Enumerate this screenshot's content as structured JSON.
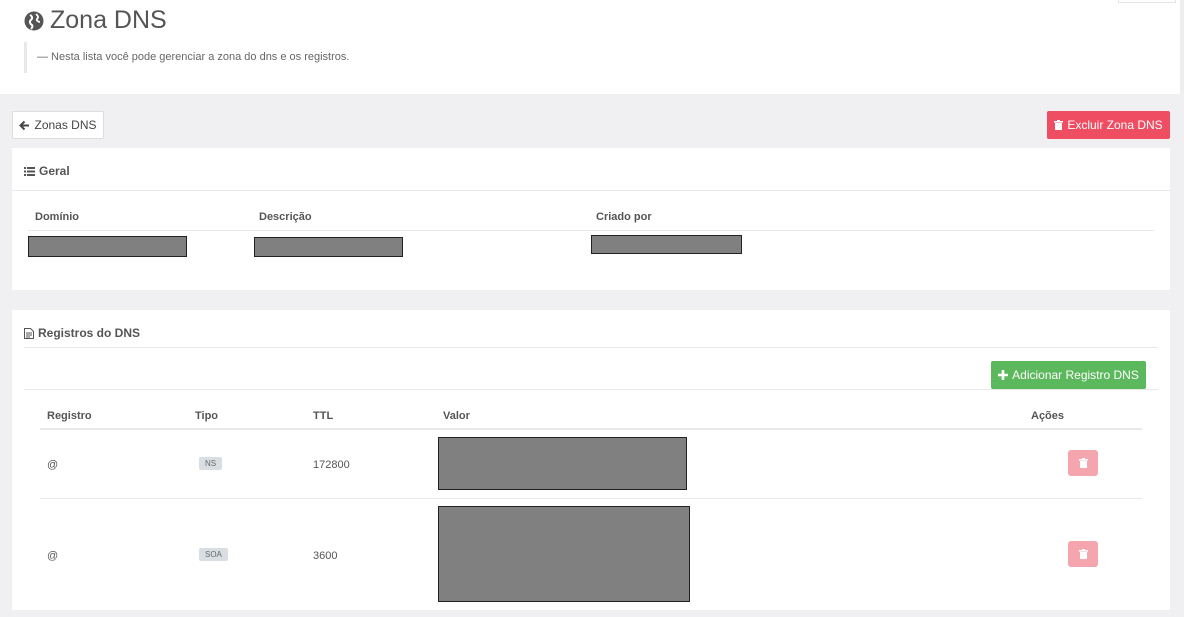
{
  "header": {
    "title": "Zona DNS",
    "description": "— Nesta lista você pode gerenciar a zona do dns e os registros."
  },
  "toolbar": {
    "back_label": "Zonas DNS",
    "delete_zone_label": "Excluir Zona DNS"
  },
  "geral": {
    "title": "Geral",
    "columns": [
      "Domínio",
      "Descrição",
      "Criado por"
    ]
  },
  "registros": {
    "title": "Registros do DNS",
    "add_label": "Adicionar Registro DNS",
    "columns": [
      "Registro",
      "Tipo",
      "TTL",
      "Valor",
      "Ações"
    ],
    "rows": [
      {
        "registro": "@",
        "tipo": "NS",
        "ttl": "172800"
      },
      {
        "registro": "@",
        "tipo": "SOA",
        "ttl": "3600"
      }
    ]
  },
  "colors": {
    "danger": "#ee4d62",
    "success": "#5cb85c",
    "danger_light": "#f5a5ae",
    "background": "#f0f0f2"
  }
}
